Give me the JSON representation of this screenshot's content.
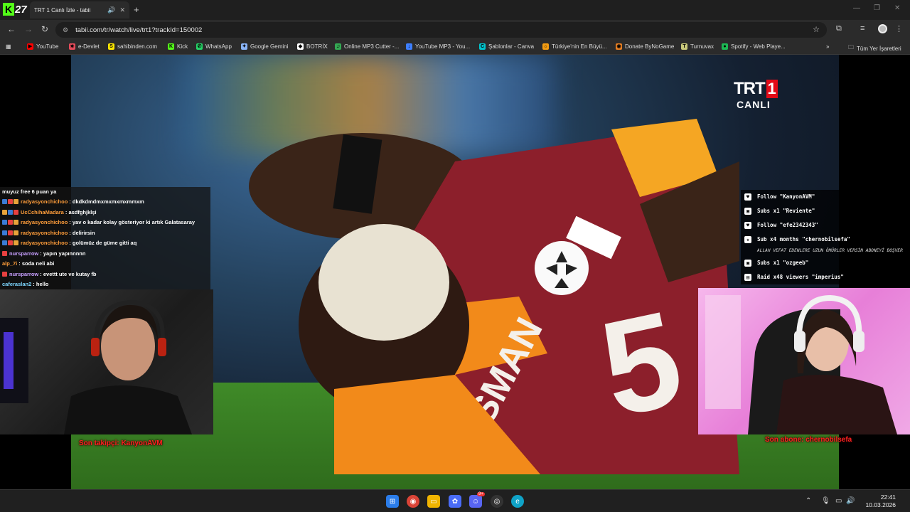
{
  "browser": {
    "badge_letter": "K",
    "badge_number": "27",
    "tab_title": "TRT 1 Canlı İzle - tabii",
    "url": "tabii.com/tr/watch/live/trt1?trackId=150002"
  },
  "bookmarks": [
    {
      "label": "YouTube",
      "icon_color": "#ff0000",
      "glyph": "▶"
    },
    {
      "label": "e-Devlet",
      "icon_color": "#e74c5b",
      "glyph": "⎈"
    },
    {
      "label": "sahibinden.com",
      "icon_color": "#ffe800",
      "glyph": "S"
    },
    {
      "label": "Kick",
      "icon_color": "#53fc18",
      "glyph": "K"
    },
    {
      "label": "WhatsApp",
      "icon_color": "#25d366",
      "glyph": "✆"
    },
    {
      "label": "Google Gemini",
      "icon_color": "#8ab4f8",
      "glyph": "✦"
    },
    {
      "label": "BOTRİX",
      "icon_color": "#ffffff",
      "glyph": "◆"
    },
    {
      "label": "Online MP3 Cutter -...",
      "icon_color": "#34a853",
      "glyph": "♫"
    },
    {
      "label": "YouTube MP3 - You...",
      "icon_color": "#3d7eff",
      "glyph": "↓"
    },
    {
      "label": "Şablonlar - Canva",
      "icon_color": "#00c4cc",
      "glyph": "C"
    },
    {
      "label": "Türkiye'nin En Büyü...",
      "icon_color": "#f39c12",
      "glyph": "☼"
    },
    {
      "label": "Donate ByNoGame",
      "icon_color": "#e67e22",
      "glyph": "◉"
    },
    {
      "label": "Turnuvax",
      "icon_color": "#c8c87a",
      "glyph": "T"
    },
    {
      "label": "Spotify - Web Playe...",
      "icon_color": "#1db954",
      "glyph": "●"
    }
  ],
  "bookmarks_overflow": "»",
  "all_bookmarks": "Tüm Yer İşaretleri",
  "video": {
    "channel_logo": "TRT",
    "channel_number": "1",
    "live_label": "CANLI"
  },
  "chat": {
    "first_line": "muyuz free 6 puan ya",
    "messages": [
      {
        "user": "radyasyonchichoo",
        "user_color": "#ff9d3a",
        "text": ": dkdkdmdmxmxmxmxmmxm",
        "badges": [
          "#3a7bd5",
          "#e84040",
          "#e8a33a"
        ]
      },
      {
        "user": "UcCchihaMadara",
        "user_color": "#ff9d3a",
        "text": ": asdfghjklşi",
        "badges": [
          "#e8a33a",
          "#3a7bd5",
          "#e84040"
        ]
      },
      {
        "user": "radyasyonchichoo",
        "user_color": "#ff9d3a",
        "text": ": yav o kadar kolay gösteriyor ki artık Galatasaray",
        "badges": [
          "#3a7bd5",
          "#e84040",
          "#e8a33a"
        ]
      },
      {
        "user": "radyasyonchichoo",
        "user_color": "#ff9d3a",
        "text": ": delirirsin",
        "badges": [
          "#3a7bd5",
          "#e84040",
          "#e8a33a"
        ]
      },
      {
        "user": "radyasyonchichoo",
        "user_color": "#ff9d3a",
        "text": ": golümüz de güme gitti aq",
        "badges": [
          "#3a7bd5",
          "#e84040",
          "#e8a33a"
        ]
      },
      {
        "user": "nursparrow",
        "user_color": "#c8a0ff",
        "text": ": yapın yapınnnnn",
        "badges": [
          "#e84040"
        ]
      },
      {
        "user": "alp_7i",
        "user_color": "#ff9d3a",
        "text": ": soda neli abi",
        "badges": []
      },
      {
        "user": "nursparrow",
        "user_color": "#c8a0ff",
        "text": ": evettt ute ve kutay fb",
        "badges": [
          "#e84040"
        ]
      },
      {
        "user": "caferaslan2",
        "user_color": "#7dd6ff",
        "text": ": hello",
        "badges": []
      }
    ]
  },
  "events": [
    {
      "icon": "♥",
      "text": "Follow \"KanyonAVM\""
    },
    {
      "icon": "▣",
      "text": "Subs x1 \"Reviente\""
    },
    {
      "icon": "♥",
      "text": "Follow \"efe2342343\""
    },
    {
      "icon": "★",
      "text": "Sub x4 months \"chernobilsefa\"",
      "message": "ALLAH VEFAT EDENLERE UZUN ÖMÜRLER VERSİN ABONEYİ BOŞVER"
    },
    {
      "icon": "▣",
      "text": "Subs x1 \"ozgeeb\""
    },
    {
      "icon": "▤",
      "text": "Raid x48 viewers \"imperius\""
    }
  ],
  "last_follower": "Son takipçi: KanyonAVM",
  "last_subscriber": "Son abone: chernobilsefa",
  "taskbar": {
    "time": "22:41",
    "date": "10.03.2026",
    "discord_badge": "9+"
  }
}
